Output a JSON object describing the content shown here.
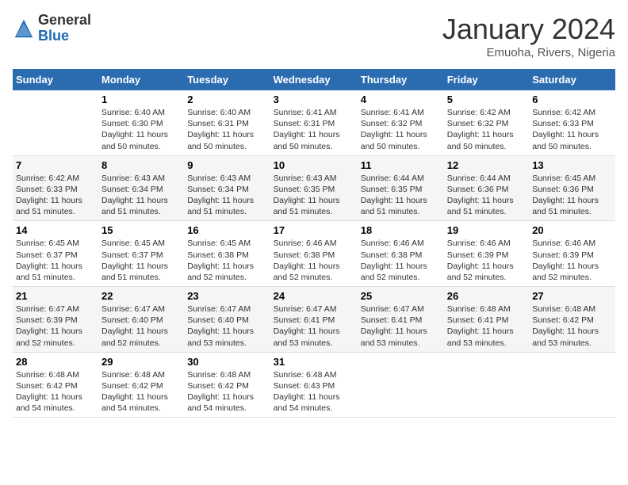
{
  "header": {
    "logo_general": "General",
    "logo_blue": "Blue",
    "month_title": "January 2024",
    "location": "Emuoha, Rivers, Nigeria"
  },
  "weekdays": [
    "Sunday",
    "Monday",
    "Tuesday",
    "Wednesday",
    "Thursday",
    "Friday",
    "Saturday"
  ],
  "weeks": [
    [
      {
        "day": "",
        "sunrise": "",
        "sunset": "",
        "daylight": ""
      },
      {
        "day": "1",
        "sunrise": "Sunrise: 6:40 AM",
        "sunset": "Sunset: 6:30 PM",
        "daylight": "Daylight: 11 hours and 50 minutes."
      },
      {
        "day": "2",
        "sunrise": "Sunrise: 6:40 AM",
        "sunset": "Sunset: 6:31 PM",
        "daylight": "Daylight: 11 hours and 50 minutes."
      },
      {
        "day": "3",
        "sunrise": "Sunrise: 6:41 AM",
        "sunset": "Sunset: 6:31 PM",
        "daylight": "Daylight: 11 hours and 50 minutes."
      },
      {
        "day": "4",
        "sunrise": "Sunrise: 6:41 AM",
        "sunset": "Sunset: 6:32 PM",
        "daylight": "Daylight: 11 hours and 50 minutes."
      },
      {
        "day": "5",
        "sunrise": "Sunrise: 6:42 AM",
        "sunset": "Sunset: 6:32 PM",
        "daylight": "Daylight: 11 hours and 50 minutes."
      },
      {
        "day": "6",
        "sunrise": "Sunrise: 6:42 AM",
        "sunset": "Sunset: 6:33 PM",
        "daylight": "Daylight: 11 hours and 50 minutes."
      }
    ],
    [
      {
        "day": "7",
        "sunrise": "Sunrise: 6:42 AM",
        "sunset": "Sunset: 6:33 PM",
        "daylight": "Daylight: 11 hours and 51 minutes."
      },
      {
        "day": "8",
        "sunrise": "Sunrise: 6:43 AM",
        "sunset": "Sunset: 6:34 PM",
        "daylight": "Daylight: 11 hours and 51 minutes."
      },
      {
        "day": "9",
        "sunrise": "Sunrise: 6:43 AM",
        "sunset": "Sunset: 6:34 PM",
        "daylight": "Daylight: 11 hours and 51 minutes."
      },
      {
        "day": "10",
        "sunrise": "Sunrise: 6:43 AM",
        "sunset": "Sunset: 6:35 PM",
        "daylight": "Daylight: 11 hours and 51 minutes."
      },
      {
        "day": "11",
        "sunrise": "Sunrise: 6:44 AM",
        "sunset": "Sunset: 6:35 PM",
        "daylight": "Daylight: 11 hours and 51 minutes."
      },
      {
        "day": "12",
        "sunrise": "Sunrise: 6:44 AM",
        "sunset": "Sunset: 6:36 PM",
        "daylight": "Daylight: 11 hours and 51 minutes."
      },
      {
        "day": "13",
        "sunrise": "Sunrise: 6:45 AM",
        "sunset": "Sunset: 6:36 PM",
        "daylight": "Daylight: 11 hours and 51 minutes."
      }
    ],
    [
      {
        "day": "14",
        "sunrise": "Sunrise: 6:45 AM",
        "sunset": "Sunset: 6:37 PM",
        "daylight": "Daylight: 11 hours and 51 minutes."
      },
      {
        "day": "15",
        "sunrise": "Sunrise: 6:45 AM",
        "sunset": "Sunset: 6:37 PM",
        "daylight": "Daylight: 11 hours and 51 minutes."
      },
      {
        "day": "16",
        "sunrise": "Sunrise: 6:45 AM",
        "sunset": "Sunset: 6:38 PM",
        "daylight": "Daylight: 11 hours and 52 minutes."
      },
      {
        "day": "17",
        "sunrise": "Sunrise: 6:46 AM",
        "sunset": "Sunset: 6:38 PM",
        "daylight": "Daylight: 11 hours and 52 minutes."
      },
      {
        "day": "18",
        "sunrise": "Sunrise: 6:46 AM",
        "sunset": "Sunset: 6:38 PM",
        "daylight": "Daylight: 11 hours and 52 minutes."
      },
      {
        "day": "19",
        "sunrise": "Sunrise: 6:46 AM",
        "sunset": "Sunset: 6:39 PM",
        "daylight": "Daylight: 11 hours and 52 minutes."
      },
      {
        "day": "20",
        "sunrise": "Sunrise: 6:46 AM",
        "sunset": "Sunset: 6:39 PM",
        "daylight": "Daylight: 11 hours and 52 minutes."
      }
    ],
    [
      {
        "day": "21",
        "sunrise": "Sunrise: 6:47 AM",
        "sunset": "Sunset: 6:39 PM",
        "daylight": "Daylight: 11 hours and 52 minutes."
      },
      {
        "day": "22",
        "sunrise": "Sunrise: 6:47 AM",
        "sunset": "Sunset: 6:40 PM",
        "daylight": "Daylight: 11 hours and 52 minutes."
      },
      {
        "day": "23",
        "sunrise": "Sunrise: 6:47 AM",
        "sunset": "Sunset: 6:40 PM",
        "daylight": "Daylight: 11 hours and 53 minutes."
      },
      {
        "day": "24",
        "sunrise": "Sunrise: 6:47 AM",
        "sunset": "Sunset: 6:41 PM",
        "daylight": "Daylight: 11 hours and 53 minutes."
      },
      {
        "day": "25",
        "sunrise": "Sunrise: 6:47 AM",
        "sunset": "Sunset: 6:41 PM",
        "daylight": "Daylight: 11 hours and 53 minutes."
      },
      {
        "day": "26",
        "sunrise": "Sunrise: 6:48 AM",
        "sunset": "Sunset: 6:41 PM",
        "daylight": "Daylight: 11 hours and 53 minutes."
      },
      {
        "day": "27",
        "sunrise": "Sunrise: 6:48 AM",
        "sunset": "Sunset: 6:42 PM",
        "daylight": "Daylight: 11 hours and 53 minutes."
      }
    ],
    [
      {
        "day": "28",
        "sunrise": "Sunrise: 6:48 AM",
        "sunset": "Sunset: 6:42 PM",
        "daylight": "Daylight: 11 hours and 54 minutes."
      },
      {
        "day": "29",
        "sunrise": "Sunrise: 6:48 AM",
        "sunset": "Sunset: 6:42 PM",
        "daylight": "Daylight: 11 hours and 54 minutes."
      },
      {
        "day": "30",
        "sunrise": "Sunrise: 6:48 AM",
        "sunset": "Sunset: 6:42 PM",
        "daylight": "Daylight: 11 hours and 54 minutes."
      },
      {
        "day": "31",
        "sunrise": "Sunrise: 6:48 AM",
        "sunset": "Sunset: 6:43 PM",
        "daylight": "Daylight: 11 hours and 54 minutes."
      },
      {
        "day": "",
        "sunrise": "",
        "sunset": "",
        "daylight": ""
      },
      {
        "day": "",
        "sunrise": "",
        "sunset": "",
        "daylight": ""
      },
      {
        "day": "",
        "sunrise": "",
        "sunset": "",
        "daylight": ""
      }
    ]
  ]
}
